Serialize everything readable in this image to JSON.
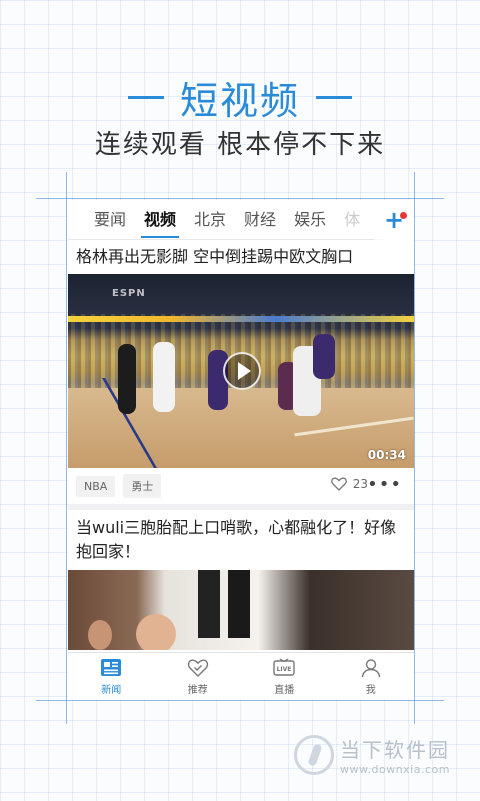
{
  "promo": {
    "headline": "短视频",
    "subheadline": "连续观看 根本停不下来"
  },
  "tabs": [
    {
      "label": "要闻"
    },
    {
      "label": "视频",
      "active": true
    },
    {
      "label": "北京"
    },
    {
      "label": "财经"
    },
    {
      "label": "娱乐"
    },
    {
      "label": "体"
    }
  ],
  "tab_add": {
    "icon": "plus-icon",
    "badge_color": "#e53935"
  },
  "feed": {
    "item1": {
      "title": "格林再出无影脚 空中倒挂踢中欧文胸口",
      "video_brand": "ESPN",
      "duration": "00:34",
      "tags": [
        "NBA",
        "勇士"
      ],
      "likes": "23",
      "more": "•••"
    },
    "item2": {
      "title": "当wuli三胞胎配上口哨歌，心都融化了！好像抱回家！"
    }
  },
  "bottom_nav": [
    {
      "label": "新闻",
      "icon": "news-icon",
      "active": true
    },
    {
      "label": "推荐",
      "icon": "heart-check-icon"
    },
    {
      "label": "直播",
      "icon": "live-tv-icon"
    },
    {
      "label": "我",
      "icon": "user-icon"
    }
  ],
  "watermark": {
    "name": "当下软件园",
    "url": "www.downxia.com"
  },
  "colors": {
    "accent": "#2a8bd8",
    "text": "#222222"
  }
}
